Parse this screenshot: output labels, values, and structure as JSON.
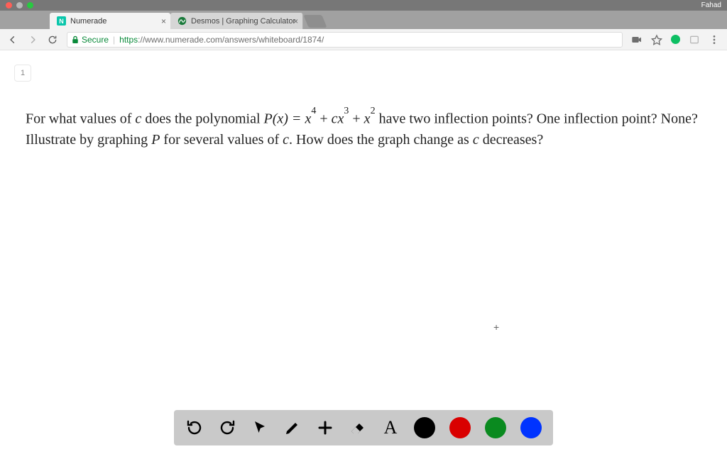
{
  "frame": {
    "user": "Fahad"
  },
  "window_controls": {
    "close_color": "#ff5f57",
    "min_color": "#b8b8b8",
    "max_color": "#28c940"
  },
  "tabs": [
    {
      "label": "Numerade",
      "active": true
    },
    {
      "label": "Desmos | Graphing Calculator",
      "active": false
    }
  ],
  "address_bar": {
    "secure_label": "Secure",
    "url_scheme": "https",
    "url_path": "://www.numerade.com/answers/whiteboard/1874/"
  },
  "page": {
    "number": "1"
  },
  "question": {
    "text1": "For what values of ",
    "c1": "c",
    "text2": " does the polynomial ",
    "poly_lhs": "P(x) = ",
    "term_x4": "x",
    "exp4": "4",
    "plus1": " + ",
    "term_cx3_c": "c",
    "term_cx3_x": "x",
    "exp3": "3",
    "plus2": " + ",
    "term_x2": "x",
    "exp2": "2",
    "text3": " have two inflection points? One inflection point? None? Illustrate by graphing ",
    "P": "P",
    "text4": " for several values of ",
    "c2": "c",
    "text5": ". How does the graph change as ",
    "c3": "c",
    "text6": " decreases?"
  },
  "center_plus": "+",
  "toolbar": {
    "text_label": "A",
    "colors": {
      "black": "#000000",
      "red": "#d90000",
      "green": "#0a8a1f",
      "blue": "#0033ff"
    }
  }
}
